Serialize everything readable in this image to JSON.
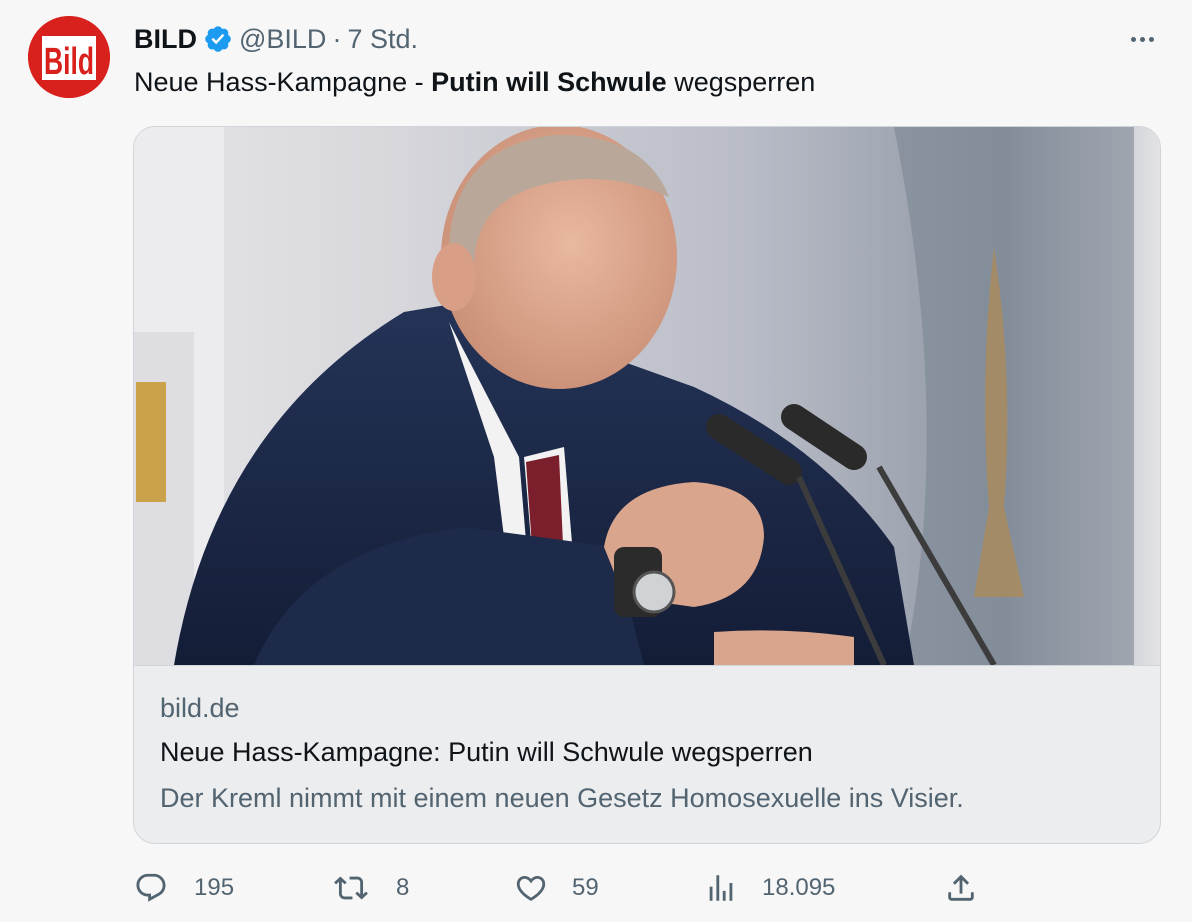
{
  "tweet": {
    "author_name": "BILD",
    "handle": "@BILD",
    "separator": "·",
    "time": "7 Std.",
    "text_pre": "Neue Hass-Kampagne - ",
    "text_bold": "Putin will Schwule",
    "text_post": " wegsperren"
  },
  "avatar": {
    "logo_text": "Bild",
    "brand_color": "#d8201c"
  },
  "verified_color": "#1d9bf0",
  "card": {
    "domain": "bild.de",
    "title": "Neue Hass-Kampagne: Putin will Schwule wegsperren",
    "description": "Der Kreml nimmt mit einem neuen Gesetz Homosexuelle ins Visier."
  },
  "actions": {
    "reply": {
      "icon": "reply-icon",
      "count": "195"
    },
    "retweet": {
      "icon": "retweet-icon",
      "count": "8"
    },
    "like": {
      "icon": "heart-icon",
      "count": "59"
    },
    "views": {
      "icon": "views-icon",
      "count": "18.095"
    },
    "share": {
      "icon": "share-icon"
    }
  }
}
